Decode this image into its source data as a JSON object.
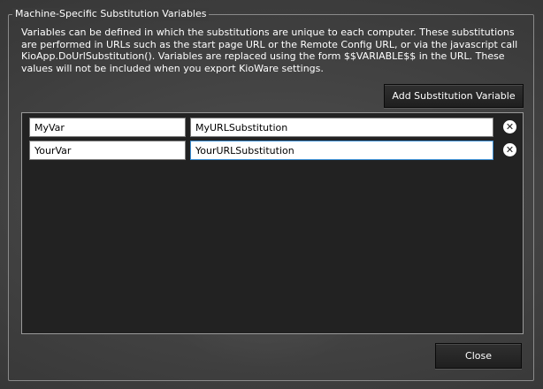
{
  "group": {
    "title": "Machine-Specific Substitution Variables",
    "description": "Variables can be defined in which the substitutions are unique to each computer. These substitutions are performed in URLs such as the start page URL or the Remote Config URL, or via the javascript call KioApp.DoUrlSubstitution(). Variables are replaced using the form $$VARIABLE$$ in the URL. These values will not be included when you export KioWare settings."
  },
  "add_button_label": "Add Substitution Variable",
  "variables": [
    {
      "name": "MyVar",
      "value": "MyURLSubstitution"
    },
    {
      "name": "YourVar",
      "value": "YourURLSubstitution"
    }
  ],
  "remove_icon": "close-circle-icon",
  "close_button_label": "Close",
  "colors": {
    "background": "#3c3c3c",
    "list_panel": "#222222",
    "button": "#262626",
    "focus_border": "#3c8fd4"
  }
}
